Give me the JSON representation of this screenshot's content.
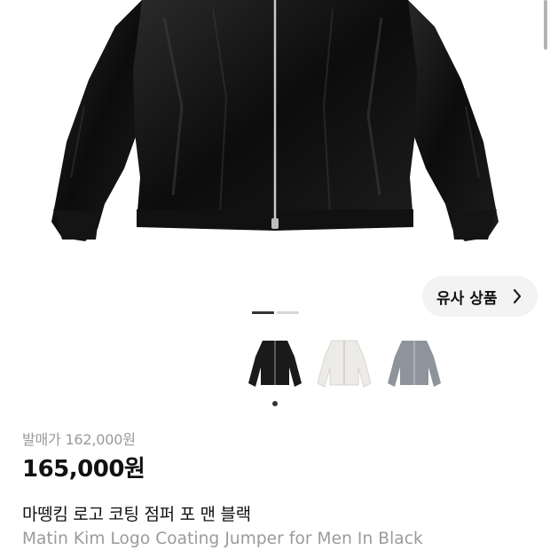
{
  "similar_products": {
    "label": "유사 상품",
    "icon": "chevron-right-icon"
  },
  "gallery": {
    "slide_count": 2,
    "active_slide": 1
  },
  "variants": [
    {
      "name": "black-jacket",
      "color": "#1a1a1a",
      "selected": true
    },
    {
      "name": "white-jacket",
      "color": "#ecebe8",
      "selected": false
    },
    {
      "name": "grey-jacket",
      "color": "#8f939b",
      "selected": false
    }
  ],
  "price": {
    "original_label": "발매가 162,000원",
    "sale": "165,000원"
  },
  "product": {
    "name_ko": "마뗑킴 로고 코팅 점퍼 포 맨 블랙",
    "name_en": "Matin Kim Logo Coating Jumper for Men In Black"
  }
}
